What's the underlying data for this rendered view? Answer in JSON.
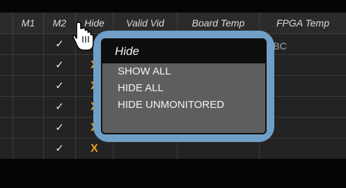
{
  "table": {
    "columns": [
      "M1",
      "M2",
      "Hide",
      "Valid Vid",
      "Board Temp",
      "FPGA Temp"
    ],
    "rows": [
      {
        "m2": "✓",
        "hide": ""
      },
      {
        "m2": "✓",
        "hide": "X"
      },
      {
        "m2": "✓",
        "hide": "X"
      },
      {
        "m2": "✓",
        "hide": "X"
      },
      {
        "m2": "✓",
        "hide": "X"
      },
      {
        "m2": "✓",
        "hide": "X"
      }
    ],
    "partial_cell_text": "SBC"
  },
  "popup": {
    "title": "Hide",
    "items": [
      "SHOW ALL",
      "HIDE ALL",
      "HIDE UNMONITORED"
    ]
  },
  "colors": {
    "accent": "#6f9fc6",
    "x_mark": "#f0a11a"
  },
  "icons": {
    "cursor": "hand-pointer-icon"
  }
}
